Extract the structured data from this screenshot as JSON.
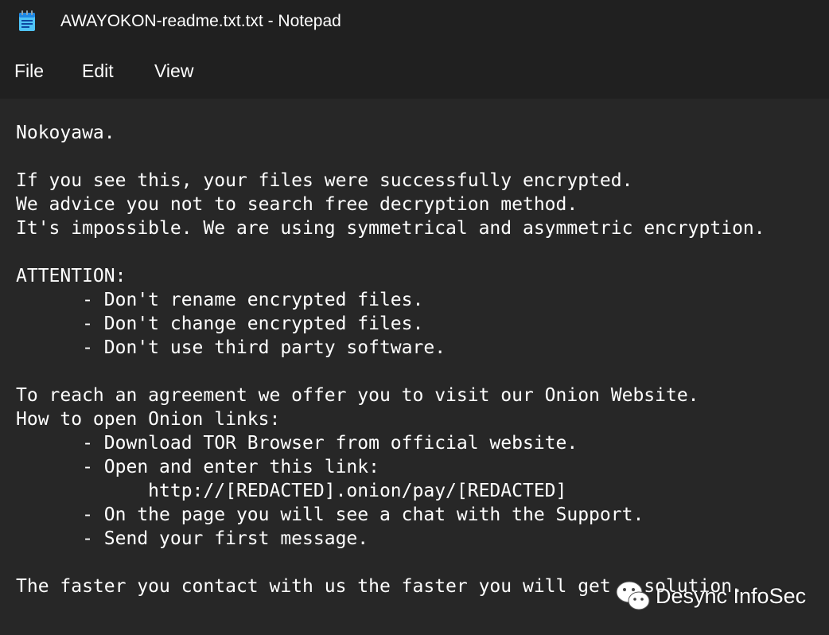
{
  "window": {
    "title": "AWAYOKON-readme.txt.txt - Notepad",
    "icon": "notepad-icon"
  },
  "menu": {
    "items": [
      {
        "label": "File"
      },
      {
        "label": "Edit"
      },
      {
        "label": "View"
      }
    ]
  },
  "document": {
    "lines": [
      "Nokoyawa.",
      "",
      "If you see this, your files were successfully encrypted.",
      "We advice you not to search free decryption method.",
      "It's impossible. We are using symmetrical and asymmetric encryption.",
      "",
      "ATTENTION:",
      "      - Don't rename encrypted files.",
      "      - Don't change encrypted files.",
      "      - Don't use third party software.",
      "",
      "To reach an agreement we offer you to visit our Onion Website.",
      "How to open Onion links:",
      "      - Download TOR Browser from official website.",
      "      - Open and enter this link:",
      "            http://[REDACTED].onion/pay/[REDACTED]",
      "      - On the page you will see a chat with the Support.",
      "      - Send your first message.",
      "",
      "The faster you contact with us the faster you will get a solution."
    ]
  },
  "watermark": {
    "text": "Desync InfoSec",
    "icon": "wechat-icon"
  },
  "colors": {
    "titlebar_bg": "#202020",
    "editor_bg": "#272727",
    "text": "#ffffff"
  }
}
